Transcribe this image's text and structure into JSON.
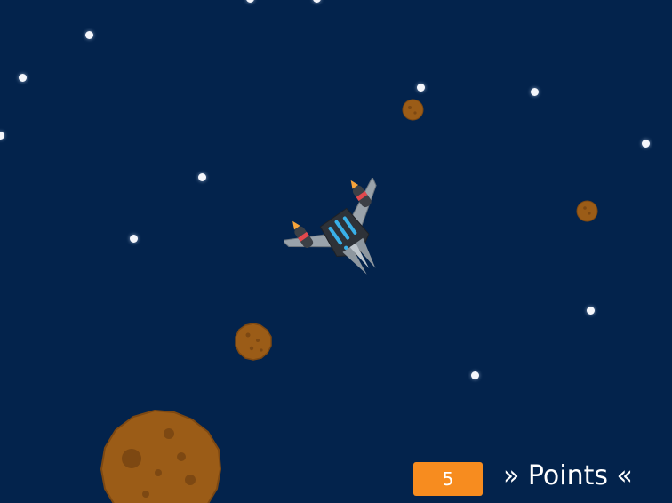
{
  "hud": {
    "score_value": "5",
    "points_label": "» Points «"
  },
  "colors": {
    "space_background": "#03234c",
    "score_box": "#f78c1f",
    "asteroid": "#9b5c17",
    "star": "#f4f6fb"
  },
  "icons": {
    "player": "spaceship-icon",
    "obstacle": "asteroid-icon",
    "background": "star-icon"
  }
}
